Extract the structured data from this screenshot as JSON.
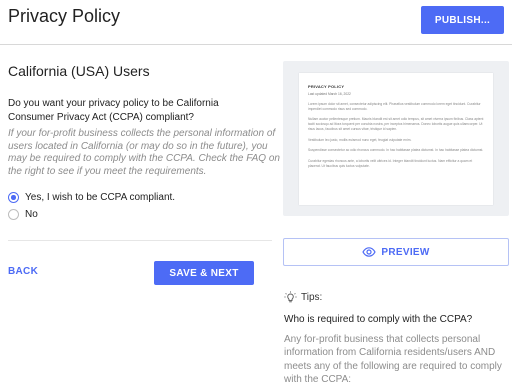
{
  "header": {
    "title": "Privacy Policy",
    "publish_label": "PUBLISH..."
  },
  "main": {
    "section_heading": "California (USA) Users",
    "question": "Do you want your privacy policy to be California Consumer Privacy Act (CCPA) compliant?",
    "hint": "If your for-profit business collects the personal information of users located in California (or may do so in the future), you may be required to comply with the CCPA. Check the FAQ on the right to see if you meet the requirements.",
    "options": [
      {
        "label": "Yes, I wish to be CCPA compliant.",
        "selected": true
      },
      {
        "label": "No",
        "selected": false
      }
    ],
    "back_label": "BACK",
    "save_next_label": "SAVE & NEXT"
  },
  "preview": {
    "doc_title": "PRIVACY POLICY",
    "doc_updated": "Last updated March 16, 2022",
    "doc_paragraphs": [
      "Lorem ipsum dolor sit amet, consectetur adipiscing elit. Phasellus vestibulum commodo lorem eget tincidunt. Curabitur imperdiet commodo risus sed commodo.",
      "Nullam auctor pellentesque pretium. Mauris blandit est sit amet odio tempus, sit amet viverra ipsum finibus. Class aptent taciti sociosqu ad litora torquent per conubia nostra, per inceptos himenaeos. Donec lobortis augue quis ullamcorper. Ut risus lacus, faucibus sit amet cursus vitae, tristique id sapien.",
      "Vestibulum leo justo, mollis euismod nunc eget, feugiat vulputate enim.",
      "Suspendisse consectetur ac odio rhoncus commodo. In hac habitasse platea dictumst. In hac habitasse platea dictumst.",
      "Curabitur egestas rhoncus ante, a lobortis velit ultrices id. Integer blandit tincidunt luctus. Nam efficitur a quam et placerat. Ut faucibus quis luctus vulputate."
    ],
    "button_label": "PREVIEW"
  },
  "tips": {
    "label": "Tips:",
    "question": "Who is required to comply with the CCPA?",
    "answer": "Any for-profit business that collects personal information from California residents/users AND meets any of the following are required to comply with the CCPA:"
  },
  "colors": {
    "accent": "#4d6bf5",
    "muted_text": "#8c8c8c"
  },
  "icons": {
    "preview": "eye-icon",
    "tips": "lightbulb-icon"
  }
}
